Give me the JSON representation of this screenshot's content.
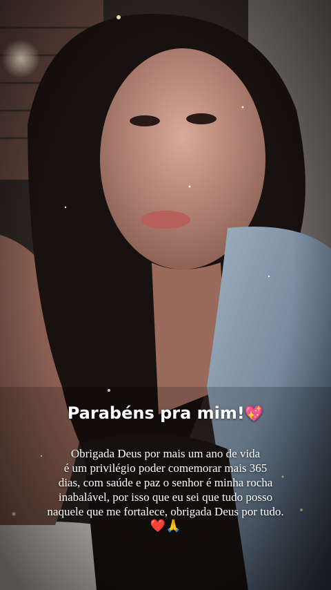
{
  "photo": {
    "title": "Parabéns pra mim!",
    "title_emoji": "💖",
    "caption_lines": [
      "Obrigada Deus por mais um ano de vida",
      "é um privilégio poder comemorar mais 365",
      "dias, com saúde e paz o senhor é minha rocha",
      "inabalável, por isso que eu sei que tudo posso",
      "naquele que me fortalece, obrigada Deus por tudo."
    ],
    "caption_emojis": "❤️🙏"
  }
}
